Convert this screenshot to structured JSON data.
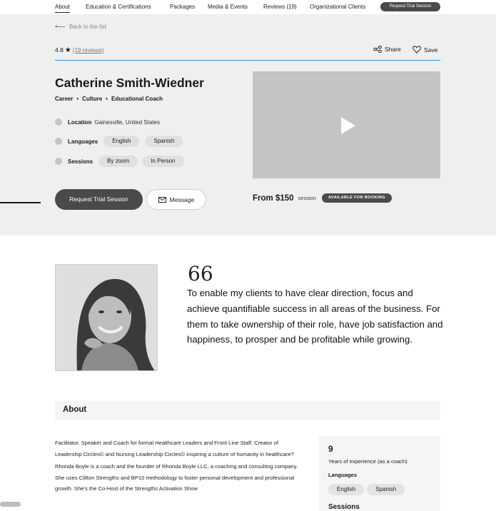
{
  "nav": {
    "items": [
      {
        "label": "About"
      },
      {
        "label": "Education & Certifications"
      },
      {
        "label": "Packages"
      },
      {
        "label": "Media & Events"
      },
      {
        "label": "Reviews (19)"
      },
      {
        "label": "Organizational Clients"
      }
    ],
    "cta_label": "Request Trial Session"
  },
  "header": {
    "back_label": "Back to the list",
    "rating": "4.8",
    "reviews_link": "(19 reviews)",
    "share_label": "Share",
    "save_label": "Save"
  },
  "profile": {
    "name": "Catherine Smith-Wiedner",
    "categories": [
      "Career",
      "Culture",
      "Educational Coach"
    ],
    "location_label": "Location",
    "location_value": "Gainesville, United States",
    "languages_label": "Languages",
    "languages": [
      "English",
      "Spanish"
    ],
    "sessions_label": "Sessions",
    "sessions": [
      "By zoom",
      "In Person"
    ]
  },
  "actions": {
    "request_label": "Request Trial Session",
    "message_label": "Message"
  },
  "pricing": {
    "from_label": "From $150",
    "unit_label": "session",
    "availability_badge": "AVAILABLE FOR BOOKING"
  },
  "quote": {
    "mark": "66",
    "text": "To enable my clients to have clear direction, focus and achieve quantifiable success in all areas of the business. For them to take ownership of their role, have job satisfaction and happiness, to prosper and be profitable while growing."
  },
  "about": {
    "title": "About",
    "paragraphs": [
      "Facilitator, Speaker and Coach for formal Healthcare Leaders and Front Line Staff. Creator of Leadership Circles© and Nursing Leadership Circles© inspiring a culture of humanity in healthcare?",
      "Rhonda Boyle is a coach and the founder of Rhonda Boyle LLC, a coaching and consulting company. She uses Clifton Strengths and BP10 methodology to foster personal development and professional growth. She's the Co-Host of the Strengths Activation Show"
    ]
  },
  "info_card": {
    "years": "9",
    "years_label": "Years of experience (as a coach)",
    "languages_label": "Languages",
    "languages": [
      "English",
      "Spanish"
    ],
    "sessions_label": "Sessions"
  },
  "icons": [
    "star-icon",
    "share-icon",
    "heart-icon",
    "back-arrow-icon",
    "mail-icon",
    "play-icon"
  ]
}
